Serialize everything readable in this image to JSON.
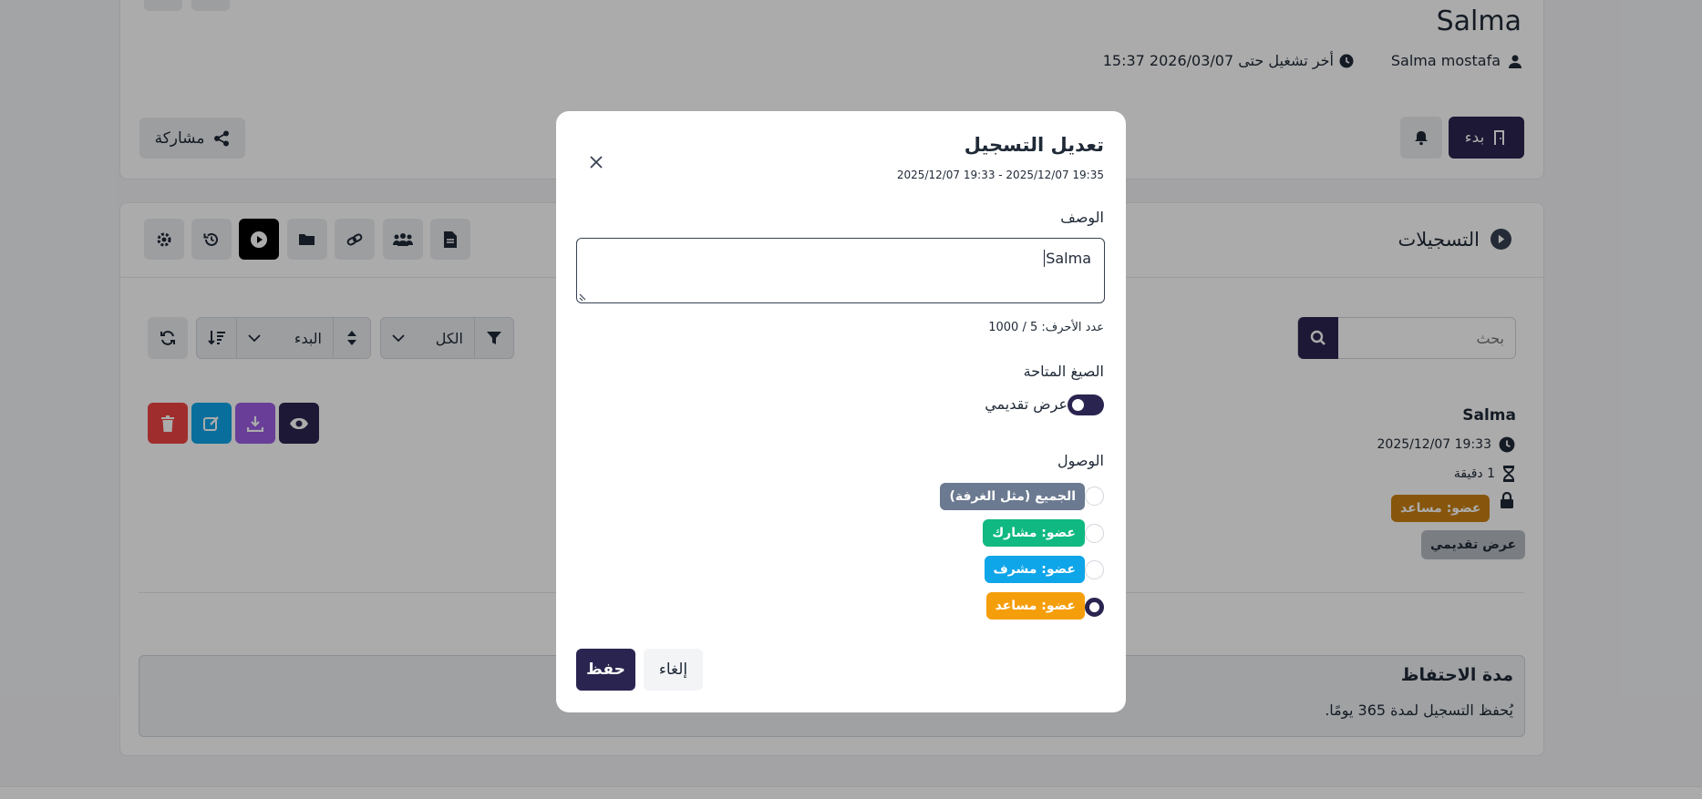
{
  "room": {
    "title": "Salma",
    "owner": "Salma mostafa",
    "last_run": "أخر تشغيل حتى 2026/03/07 15:37",
    "start_label": "بدء",
    "share_label": "مشاركة"
  },
  "recordings": {
    "title": "التسجيلات",
    "search_placeholder": "بحث",
    "filter_value": "الكل",
    "sort_value": "البدء",
    "item": {
      "name": "Salma",
      "datetime": "2025/12/07 19:33",
      "duration": "1 دقيقة",
      "access_badge": "عضو: مساعد",
      "format_badge": "عرض تقديمي"
    }
  },
  "retention": {
    "title": "مدة الاحتفاظ",
    "text": "يُحفظ التسجيل لمدة 365 يومًا."
  },
  "modal": {
    "title": "تعديل التسجيل",
    "subtitle": "2025/12/07 19:33 - 2025/12/07 19:35",
    "description_label": "الوصف",
    "description_value": "Salma",
    "char_count": "عدد الأحرف: 5 / 1000",
    "formats_label": "الصيغ المتاحة",
    "format_toggle_label": "عرض تقديمي",
    "access_label": "الوصول",
    "access_options": [
      {
        "label": "الجميع (مثل الغرفة)",
        "color": "#6b7a90",
        "checked": false
      },
      {
        "label": "عضو: مشارك",
        "color": "#10b981",
        "checked": false
      },
      {
        "label": "عضو: مشرف",
        "color": "#0ea5e9",
        "checked": false
      },
      {
        "label": "عضو: مساعد",
        "color": "#f59e0b",
        "checked": true
      }
    ],
    "save_label": "حفظ",
    "cancel_label": "إلغاء"
  },
  "colors": {
    "primary": "#2a2450",
    "danger": "#ef4444",
    "info": "#0ea5e9",
    "purple": "#9b5de5",
    "warning": "#f59e0b"
  }
}
